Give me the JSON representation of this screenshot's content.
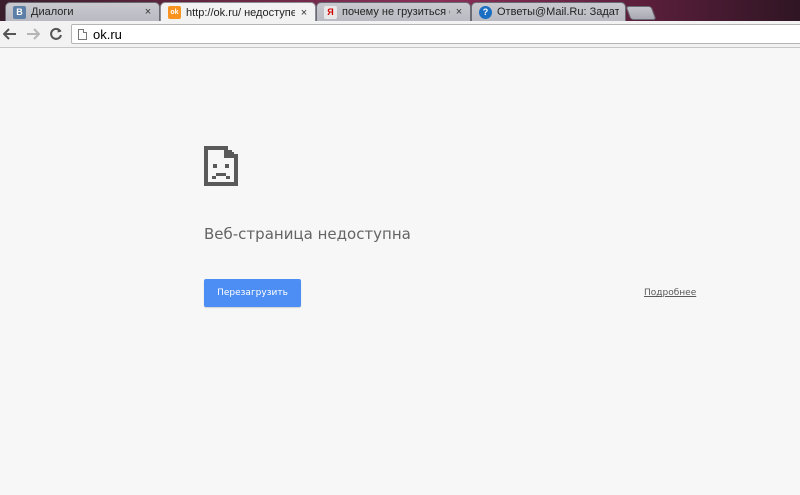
{
  "tabs": [
    {
      "title": "Диалоги",
      "favicon": "vk-icon",
      "favicon_color": "#5b7fa6",
      "favicon_glyph": "В",
      "active": false
    },
    {
      "title": "http://ok.ru/ недоступен",
      "favicon": "odnoklassniki-icon",
      "favicon_color": "#f7931e",
      "favicon_glyph": "ok",
      "active": true
    },
    {
      "title": "почему не грузиться одн",
      "favicon": "yandex-icon",
      "favicon_color": "#e8e8e8",
      "favicon_glyph": "Я",
      "active": false
    },
    {
      "title": "Ответы@Mail.Ru: Задать",
      "favicon": "mailru-answers-icon",
      "favicon_color": "#1a6fc2",
      "favicon_glyph": "?",
      "active": false
    }
  ],
  "tab_close_glyph": "×",
  "toolbar": {
    "back_icon": "back-arrow-icon",
    "forward_icon": "forward-arrow-icon",
    "reload_icon": "reload-icon",
    "url": "ok.ru"
  },
  "error_page": {
    "title": "Веб-страница недоступна",
    "reload_label": "Перезагрузить",
    "details_label": "Подробнее",
    "button_color": "#4d8ef5"
  }
}
